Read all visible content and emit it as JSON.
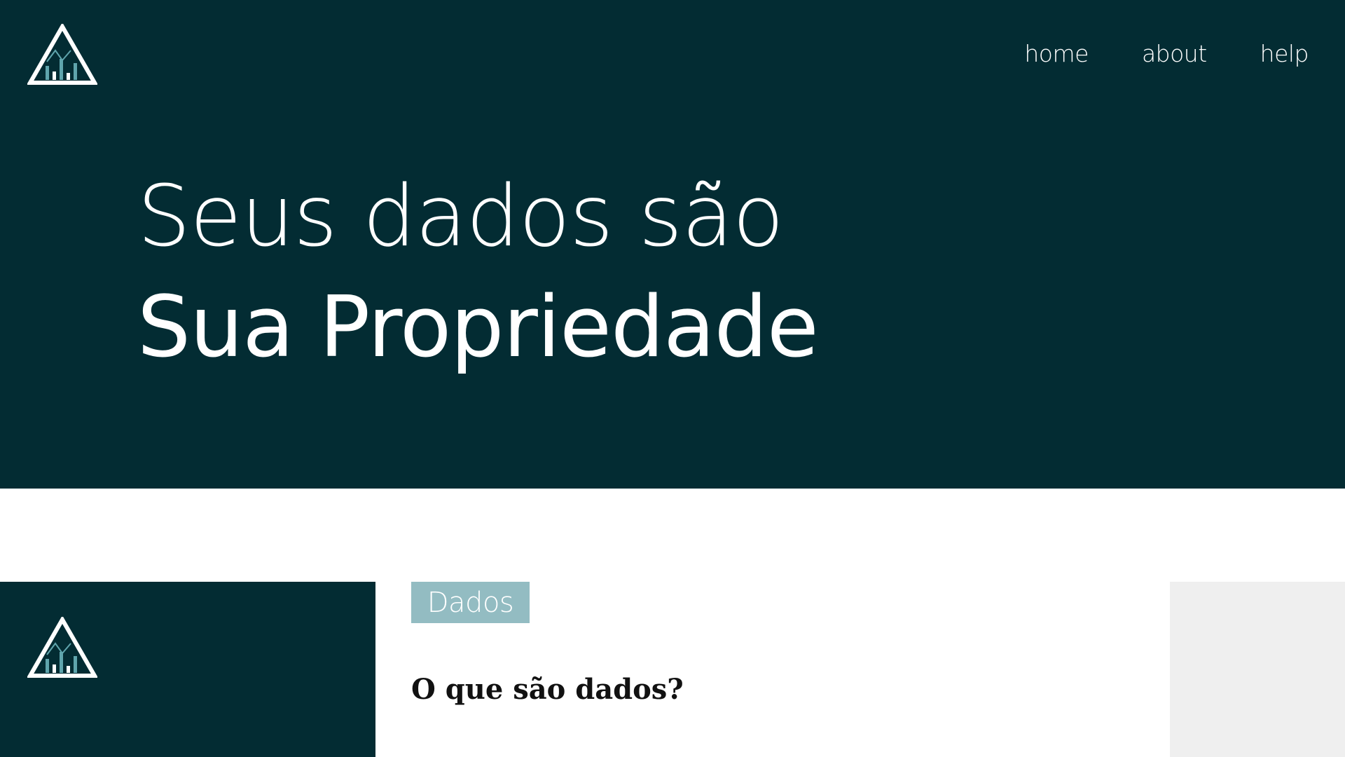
{
  "nav": {
    "items": [
      {
        "label": "home"
      },
      {
        "label": "about"
      },
      {
        "label": "help"
      }
    ]
  },
  "hero": {
    "line1": "Seus dados são",
    "line2": "Sua Propriedade"
  },
  "content": {
    "tag": "Dados",
    "question": "O que são dados?"
  },
  "colors": {
    "dark_teal": "#032c33",
    "accent_teal": "#93bcc2",
    "logo_bars": "#5fa5ad",
    "light_gray": "#efefef"
  },
  "icons": {
    "logo": "triangle-chart-logo-icon"
  }
}
